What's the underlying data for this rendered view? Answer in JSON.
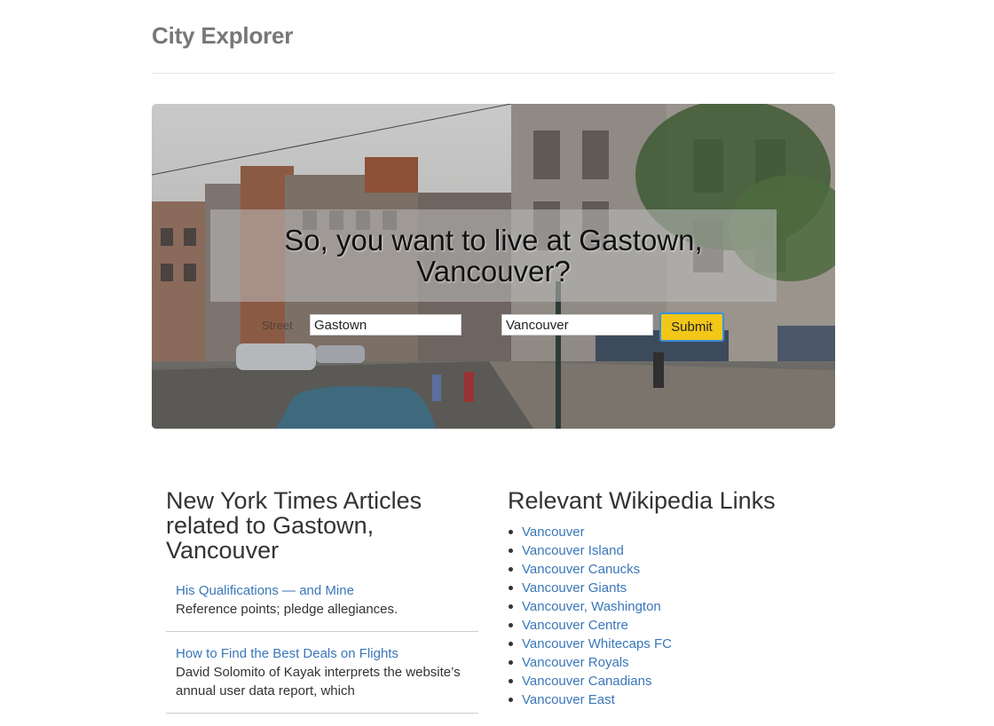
{
  "header": {
    "title": "City Explorer"
  },
  "hero": {
    "title": "So, you want to live at Gastown, Vancouver?",
    "street_label": "Street",
    "street_value": "Gastown",
    "city_value": "Vancouver",
    "submit_label": "Submit"
  },
  "nyt": {
    "heading": "New York Times Articles related to Gastown, Vancouver",
    "articles": [
      {
        "title": "His Qualifications — and Mine",
        "snippet": "Reference points; pledge allegiances."
      },
      {
        "title": "How to Find the Best Deals on Flights",
        "snippet": "David Solomito of Kayak interprets the website’s annual user data report, which"
      }
    ]
  },
  "wiki": {
    "heading": "Relevant Wikipedia Links",
    "links": [
      "Vancouver",
      "Vancouver Island",
      "Vancouver Canucks",
      "Vancouver Giants",
      "Vancouver, Washington",
      "Vancouver Centre",
      "Vancouver Whitecaps FC",
      "Vancouver Royals",
      "Vancouver Canadians",
      "Vancouver East"
    ]
  },
  "colors": {
    "link": "#3a77b8",
    "submit_bg": "#f2c718",
    "submit_border": "#3b8fd8",
    "title_gray": "#777777"
  }
}
